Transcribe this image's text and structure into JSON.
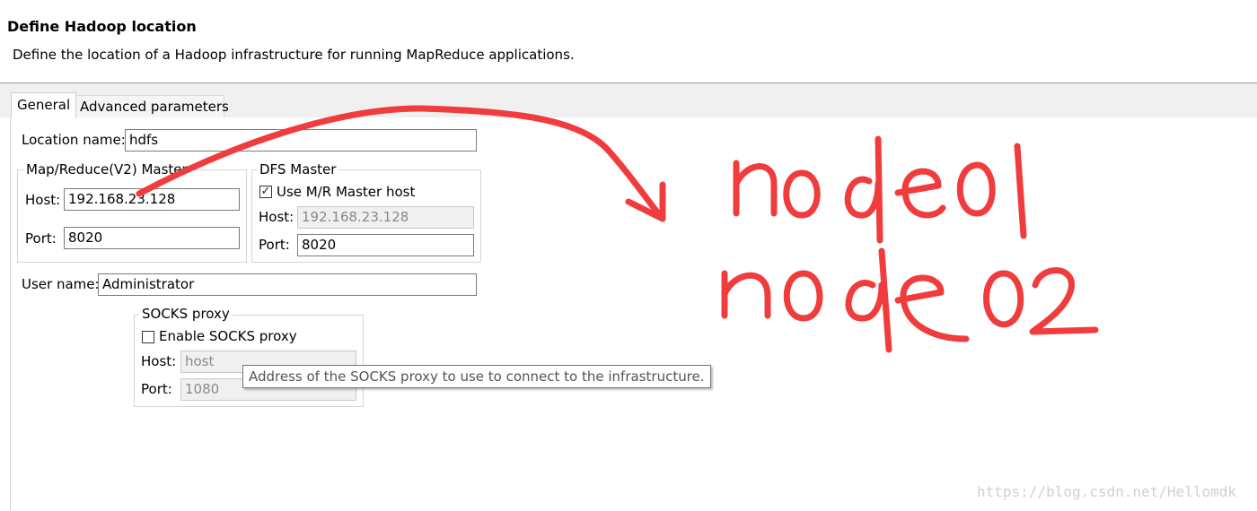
{
  "header": {
    "title": "Define Hadoop location",
    "description": "Define the location of a Hadoop infrastructure for running MapReduce applications."
  },
  "tabs": [
    {
      "label": "General",
      "active": true
    },
    {
      "label": "Advanced parameters",
      "active": false
    }
  ],
  "location": {
    "label": "Location name:",
    "value": "hdfs"
  },
  "mr_master": {
    "title": "Map/Reduce(V2) Master",
    "host_label": "Host:",
    "host_value": "192.168.23.128",
    "port_label": "Port:",
    "port_value": "8020"
  },
  "dfs_master": {
    "title": "DFS Master",
    "use_mr_label": "Use M/R Master host",
    "use_mr_checked": true,
    "host_label": "Host:",
    "host_value": "192.168.23.128",
    "port_label": "Port:",
    "port_value": "8020"
  },
  "user": {
    "label": "User name:",
    "value": "Administrator"
  },
  "socks": {
    "title": "SOCKS proxy",
    "enable_label": "Enable SOCKS proxy",
    "enable_checked": false,
    "host_label": "Host:",
    "host_value": "host",
    "port_label": "Port:",
    "port_value": "1080"
  },
  "tooltip": "Address of the SOCKS proxy to use to connect to the infrastructure.",
  "annotation": {
    "color": "#f03c3c",
    "handwritten_lines": [
      "node01",
      "node02"
    ]
  },
  "watermark": "https://blog.csdn.net/Hellomdk"
}
